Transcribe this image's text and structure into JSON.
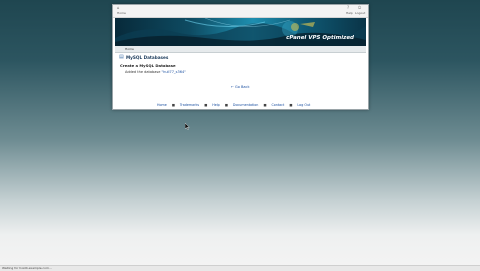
{
  "topbar": {
    "home_label": "Home",
    "help_label": "Help",
    "logout_label": "Logout"
  },
  "banner": {
    "brand": "cPanel VPS Optimized"
  },
  "breadcrumb": {
    "label": "Home"
  },
  "page": {
    "section_title": "MySQL Databases",
    "subheading": "Create a MySQL Database",
    "message_prefix": "Added the database",
    "database_name": "\"hull77_s364\"",
    "go_back": "← Go Back"
  },
  "footer": {
    "links": [
      "Home",
      "Trademarks",
      "Help",
      "Documentation",
      "Contact",
      "Log Out"
    ],
    "separator": "■"
  },
  "status_bar": {
    "text": "Waiting for host4.example.com..."
  },
  "colors": {
    "link": "#1a4fa0",
    "banner_dark": "#082a3a",
    "banner_light": "#1e8fb0"
  }
}
